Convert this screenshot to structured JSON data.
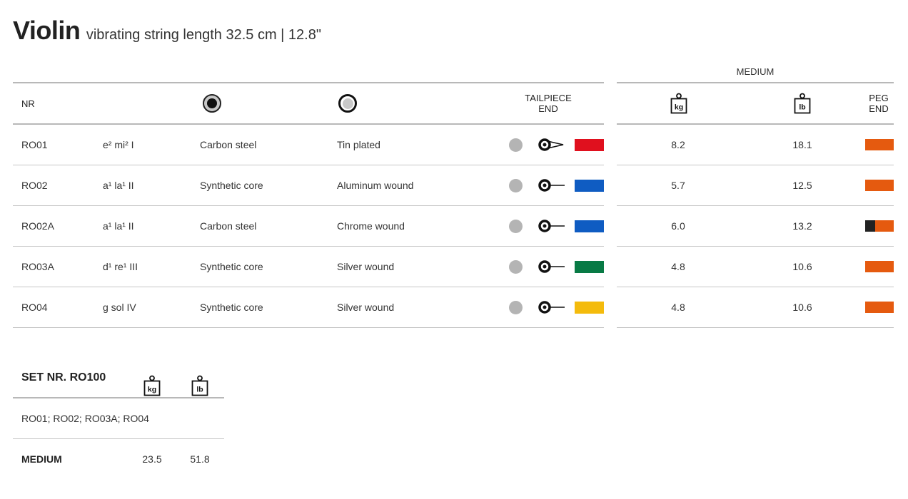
{
  "header": {
    "instrument": "Violin",
    "subtitle": "vibrating string length 32.5 cm | 12.8\""
  },
  "table": {
    "group_label": "MEDIUM",
    "columns": {
      "nr": "NR",
      "tailpiece_line1": "TAILPIECE",
      "tailpiece_line2": "END",
      "kg_unit": "kg",
      "lb_unit": "lb",
      "peg_line1": "PEG",
      "peg_line2": "END"
    },
    "rows": [
      {
        "nr": "RO01",
        "note": "e²  mi²  I",
        "core": "Carbon steel",
        "winding": "Tin plated",
        "end_type": "knot",
        "tail_color": "#e0101e",
        "kg": "8.2",
        "lb": "18.1",
        "peg_colors": [
          "#e55a0f"
        ]
      },
      {
        "nr": "RO02",
        "note": "a¹  la¹  II",
        "core": "Synthetic core",
        "winding": "Aluminum wound",
        "end_type": "ball",
        "tail_color": "#0f5cc2",
        "kg": "5.7",
        "lb": "12.5",
        "peg_colors": [
          "#e55a0f"
        ]
      },
      {
        "nr": "RO02A",
        "note": "a¹  la¹  II",
        "core": "Carbon steel",
        "winding": "Chrome wound",
        "end_type": "ball",
        "tail_color": "#0f5cc2",
        "kg": "6.0",
        "lb": "13.2",
        "peg_colors": [
          "#222222",
          "#e55a0f"
        ]
      },
      {
        "nr": "RO03A",
        "note": "d¹  re¹  III",
        "core": "Synthetic core",
        "winding": "Silver wound",
        "end_type": "ball",
        "tail_color": "#087a45",
        "kg": "4.8",
        "lb": "10.6",
        "peg_colors": [
          "#e55a0f"
        ]
      },
      {
        "nr": "RO04",
        "note": "g  sol  IV",
        "core": "Synthetic core",
        "winding": "Silver wound",
        "end_type": "ball",
        "tail_color": "#f4bb0c",
        "kg": "4.8",
        "lb": "10.6",
        "peg_colors": [
          "#e55a0f"
        ]
      }
    ]
  },
  "set": {
    "title": "SET NR. RO100",
    "kg_unit": "kg",
    "lb_unit": "lb",
    "contents": "RO01; RO02; RO03A; RO04",
    "tension_label": "MEDIUM",
    "kg": "23.5",
    "lb": "51.8"
  },
  "icons": {
    "core": "string-core-icon",
    "winding": "string-winding-icon",
    "weight": "weight-icon",
    "ball_end": "ball-end-icon",
    "loop_end": "loop-end-icon"
  }
}
